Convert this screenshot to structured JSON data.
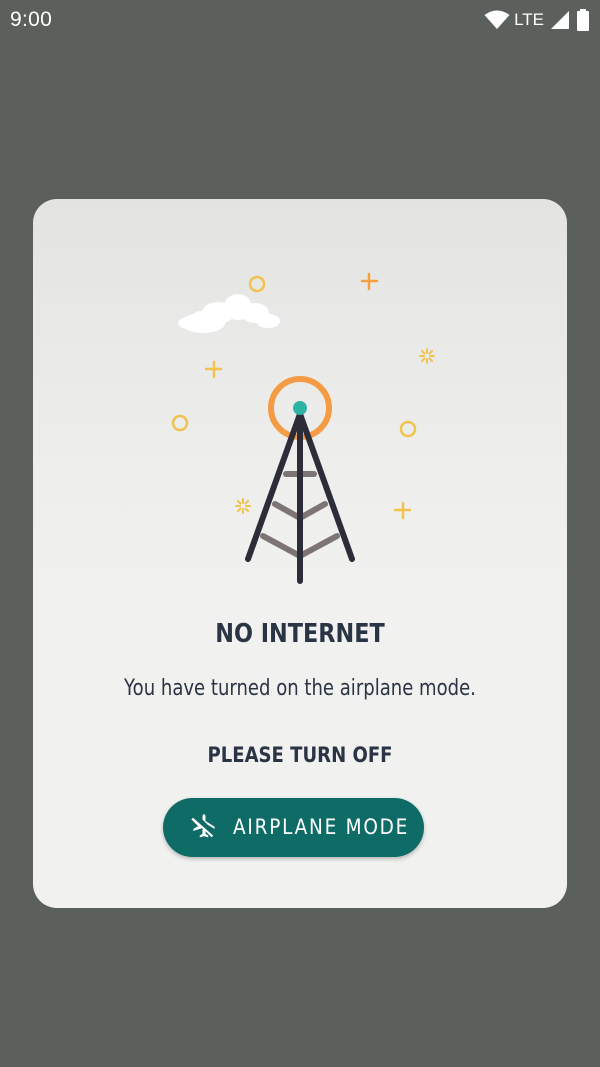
{
  "status_bar": {
    "time": "9:00",
    "network": "LTE"
  },
  "dialog": {
    "title": "NO INTERNET",
    "message": "You have turned on the airplane mode.",
    "instruction": "PLEASE TURN OFF",
    "button_label": "AIRPLANE MODE",
    "button_icon": "airplane-off-icon",
    "illustration": "cell-tower-icon"
  },
  "colors": {
    "background": "#5c605c",
    "card": "#f1f2f0",
    "button": "#0f6b66",
    "text": "#2b3444",
    "tower_ring": "#f59a45",
    "tower_dot": "#2bb3a3",
    "sparkle": "#f2c14e"
  }
}
